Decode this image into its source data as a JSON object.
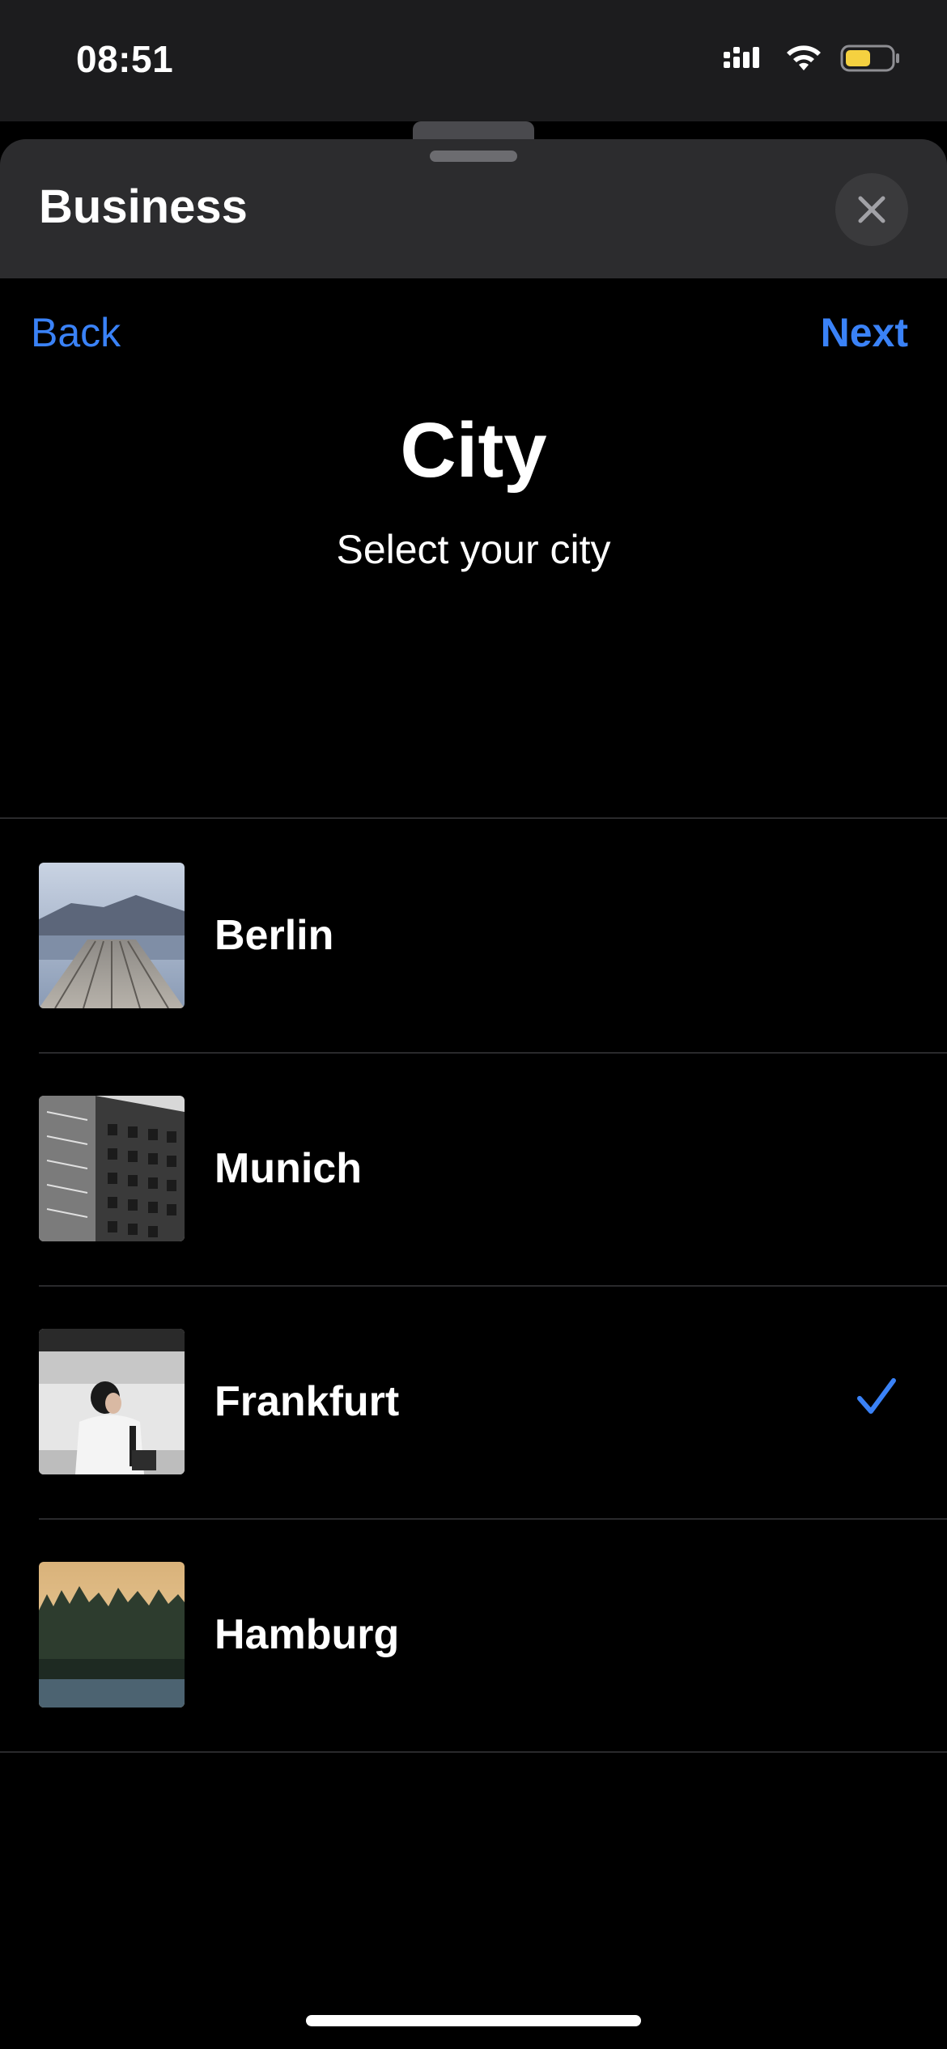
{
  "status_bar": {
    "time": "08:51",
    "icons": [
      "cellular-signal-icon",
      "wifi-icon",
      "battery-icon"
    ],
    "battery_color": "#f5d140"
  },
  "sheet": {
    "title": "Business",
    "close_icon": "close-icon"
  },
  "nav": {
    "back_label": "Back",
    "next_label": "Next"
  },
  "page": {
    "title": "City",
    "subtitle": "Select your city"
  },
  "cities": [
    {
      "name": "Berlin",
      "image": "pier-landscape-photo",
      "selected": false
    },
    {
      "name": "Munich",
      "image": "building-facade-photo",
      "selected": false
    },
    {
      "name": "Frankfurt",
      "image": "woman-commuter-photo",
      "selected": true
    },
    {
      "name": "Hamburg",
      "image": "forest-treeline-photo",
      "selected": false
    }
  ],
  "colors": {
    "accent": "#3a82f7",
    "sheet_header": "#2c2c2e",
    "background": "#000000"
  }
}
